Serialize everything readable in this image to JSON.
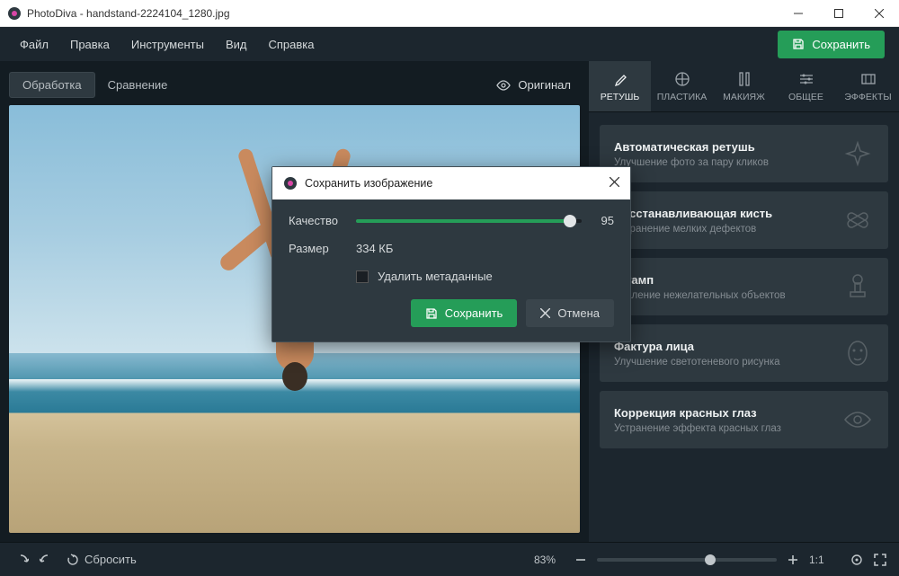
{
  "window": {
    "app_name": "PhotoDiva",
    "file_name": "handstand-2224104_1280.jpg",
    "title": "PhotoDiva - handstand-2224104_1280.jpg"
  },
  "menu": {
    "items": [
      "Файл",
      "Правка",
      "Инструменты",
      "Вид",
      "Справка"
    ],
    "save_label": "Сохранить"
  },
  "canvas": {
    "tab_edit": "Обработка",
    "tab_compare": "Сравнение",
    "original_btn": "Оригинал"
  },
  "categories": [
    {
      "label": "РЕТУШЬ"
    },
    {
      "label": "ПЛАСТИКА"
    },
    {
      "label": "МАКИЯЖ"
    },
    {
      "label": "ОБЩЕЕ"
    },
    {
      "label": "ЭФФЕКТЫ"
    }
  ],
  "tools": [
    {
      "title": "Автоматическая ретушь",
      "desc": "Улучшение фото за пару кликов"
    },
    {
      "title": "Восстанавливающая кисть",
      "desc": "Устранение мелких дефектов"
    },
    {
      "title": "Штамп",
      "desc": "Удаление нежелательных объектов"
    },
    {
      "title": "Фактура лица",
      "desc": "Улучшение светотеневого рисунка"
    },
    {
      "title": "Коррекция красных глаз",
      "desc": "Устранение эффекта красных глаз"
    }
  ],
  "bottom": {
    "reset": "Сбросить",
    "zoom_pct": "83%",
    "ratio": "1:1"
  },
  "dialog": {
    "title": "Сохранить изображение",
    "quality_label": "Качество",
    "quality_value": "95",
    "size_label": "Размер",
    "size_value": "334 КБ",
    "remove_meta": "Удалить метаданные",
    "save": "Сохранить",
    "cancel": "Отмена"
  }
}
